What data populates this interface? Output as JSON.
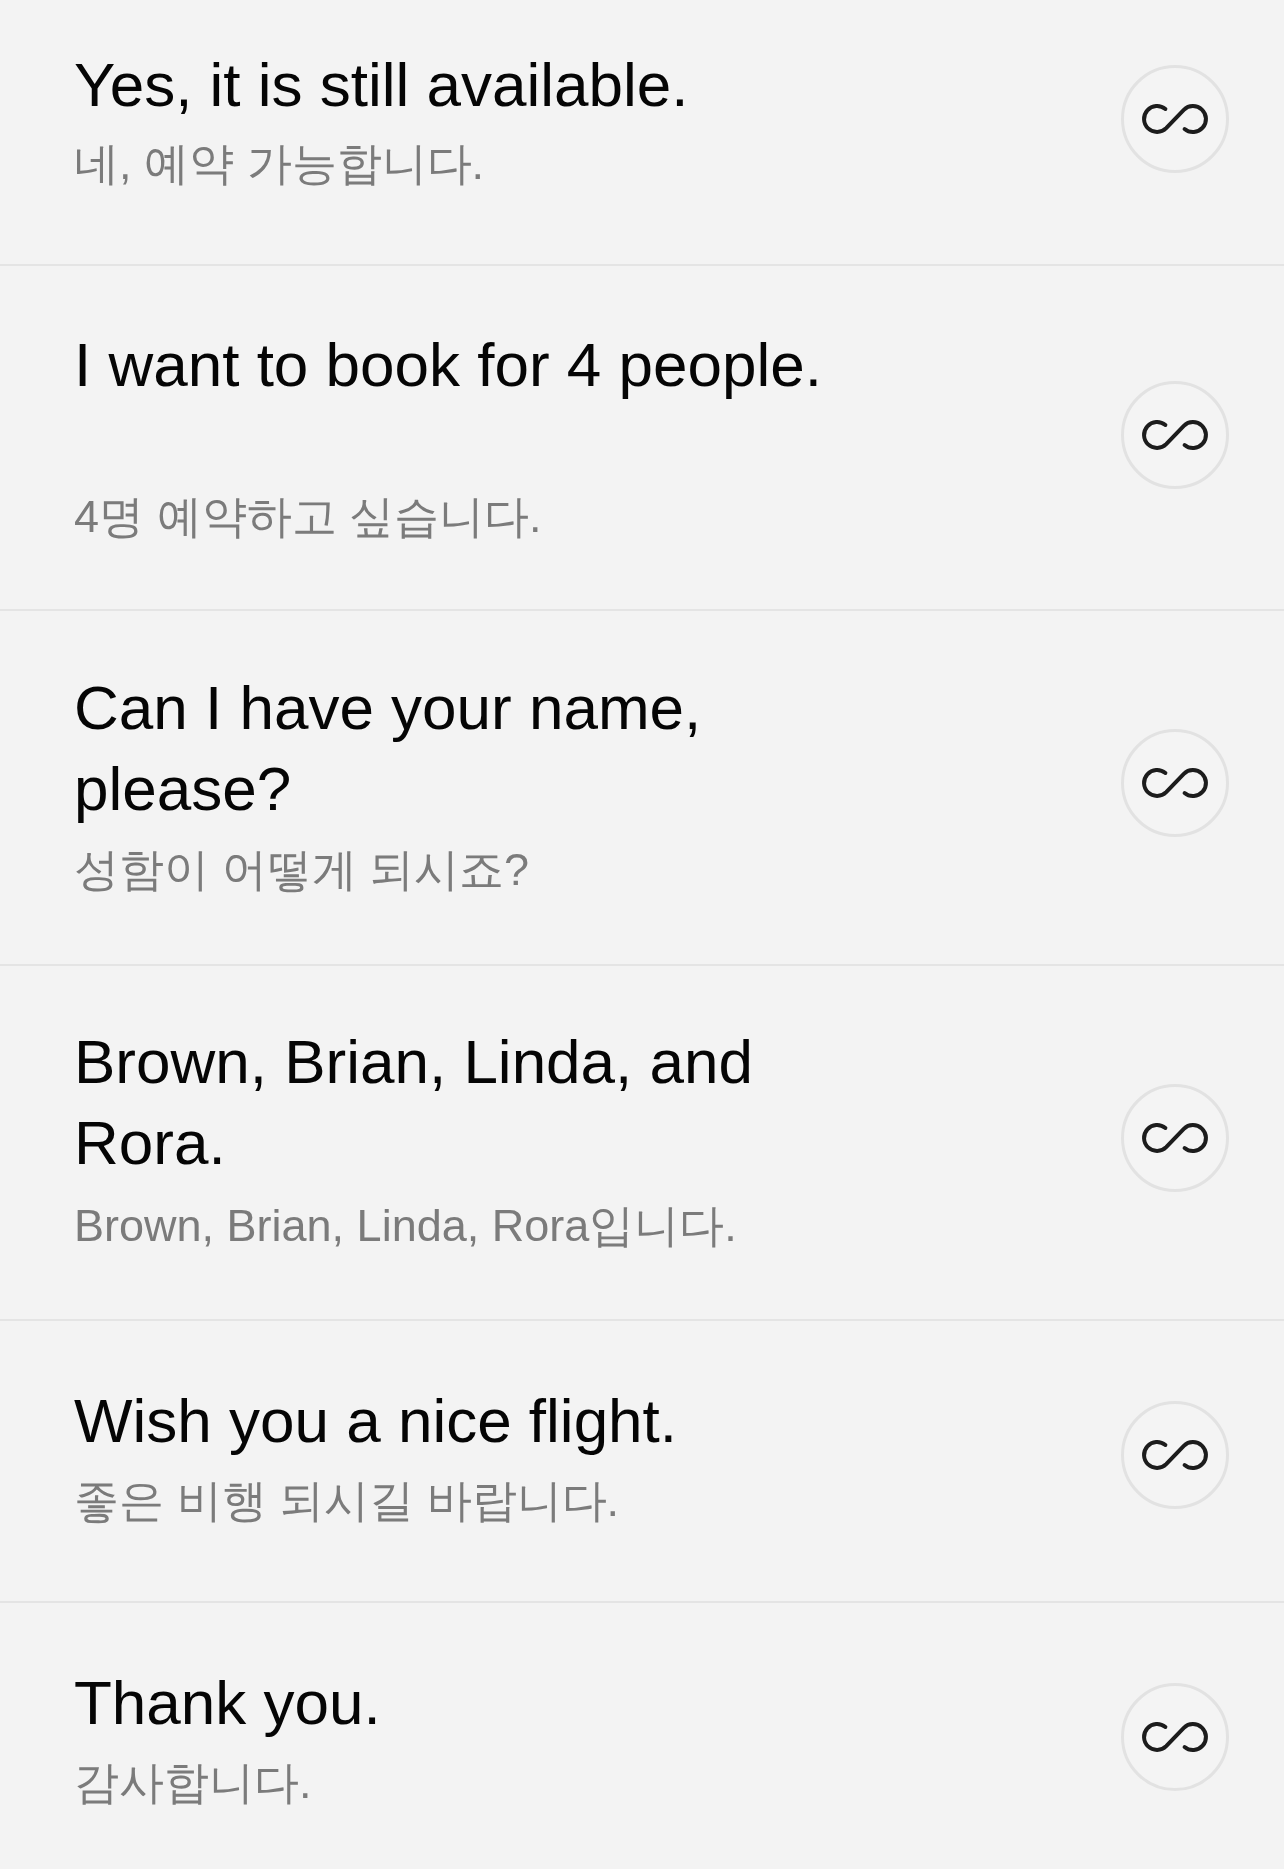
{
  "phrases": [
    {
      "text": "Yes, it is still available.",
      "translation": "네, 예약 가능합니다."
    },
    {
      "text": "I want to book for 4 people.",
      "translation": "4명 예약하고 싶습니다."
    },
    {
      "text": "Can I have your name, please?",
      "translation": "성함이 어떻게 되시죠?"
    },
    {
      "text": "Brown, Brian, Linda, and Rora.",
      "translation": "Brown, Brian, Linda, Rora입니다."
    },
    {
      "text": "Wish you a nice flight.",
      "translation": "좋은 비행 되시길 바랍니다."
    },
    {
      "text": "Thank you.",
      "translation": "감사합니다."
    }
  ]
}
